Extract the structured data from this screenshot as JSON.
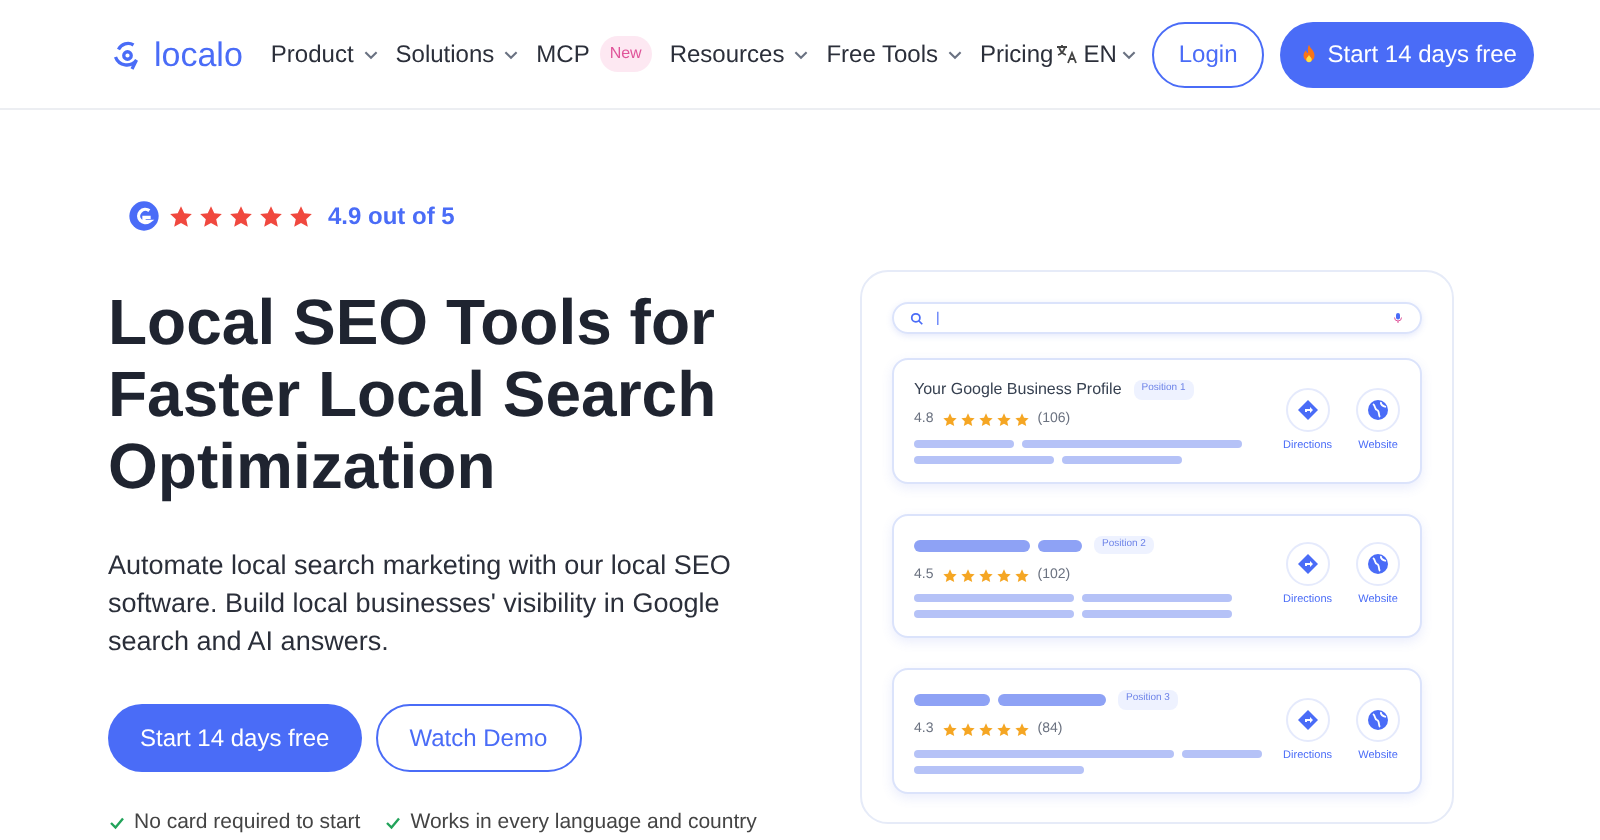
{
  "nav": {
    "logo": "localo",
    "items": [
      {
        "label": "Product",
        "dropdown": true
      },
      {
        "label": "Solutions",
        "dropdown": true
      },
      {
        "label": "MCP",
        "dropdown": false,
        "badge": "New"
      },
      {
        "label": "Resources",
        "dropdown": true
      },
      {
        "label": "Free Tools",
        "dropdown": true
      },
      {
        "label": "Pricing",
        "dropdown": false
      }
    ],
    "language": "EN",
    "login": "Login",
    "cta": "Start 14 days free"
  },
  "hero": {
    "rating": {
      "stars": 5,
      "text": "4.9 out of 5"
    },
    "title": "Local SEO Tools for Faster Local Search Optimization",
    "subtitle": "Automate local search marketing with our local SEO software. Build local businesses' visibility in Google search and AI answers.",
    "primary_button": "Start 14 days free",
    "secondary_button": "Watch Demo",
    "checks": [
      "No card required to start",
      "Works in every language and country"
    ]
  },
  "mockup": {
    "search_value": "|",
    "results": [
      {
        "name": "Your Google Business Profile",
        "position": "Position 1",
        "rating": "4.8",
        "stars": 5,
        "reviews": "(106)",
        "directions": "Directions",
        "website": "Website"
      },
      {
        "position": "Position 2",
        "rating": "4.5",
        "stars": 5,
        "reviews": "(102)",
        "directions": "Directions",
        "website": "Website"
      },
      {
        "position": "Position 3",
        "rating": "4.3",
        "stars": 5,
        "reviews": "(84)",
        "directions": "Directions",
        "website": "Website"
      }
    ]
  }
}
